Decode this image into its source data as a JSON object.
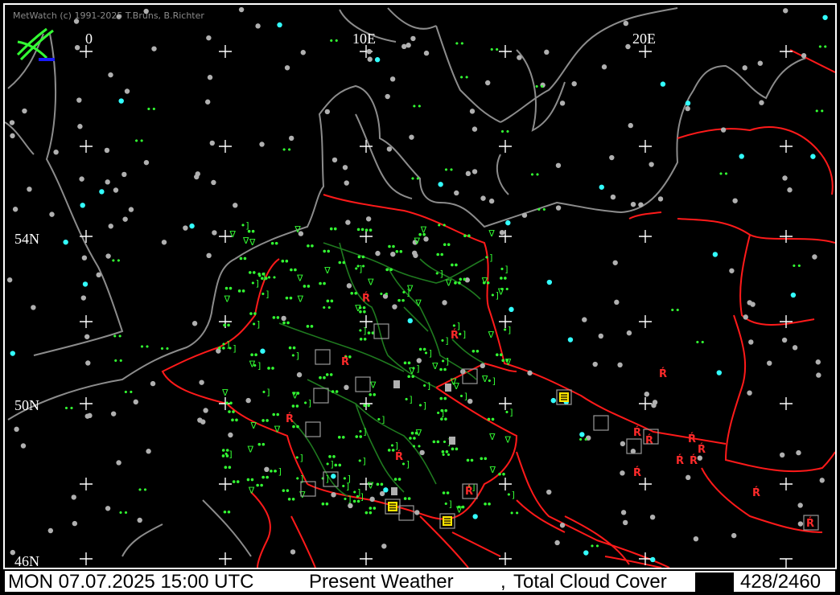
{
  "credit": "MetWatch  (c) 1991-2025 T.Bruns, B.Richter",
  "grid_labels": {
    "lon_0": "0",
    "lon_10": "10E",
    "lon_20": "20E",
    "lat_54": "54N",
    "lat_50": "50N",
    "lat_46": "46N"
  },
  "status": {
    "datetime": "MON 07.07.2025 15:00 UTC",
    "product": "Present Weather",
    "separator": ",",
    "secondary": "Total Cloud Cover",
    "count": "428/2460"
  },
  "colors": {
    "coastline": "#8c8c8c",
    "borders": "#ff1a1a",
    "german_states": "#1f7a1f",
    "weather_symbols": "#33ff33",
    "thunder_symbols": "#ff2a2a",
    "cloud_cover_dots": "#b0b0b0",
    "clear_dots": "#33ffff",
    "grid_crosses": "#ffffff"
  },
  "legend_icons": [
    "metwatch-logo-icon",
    "drizzle-icon",
    "rain-icon",
    "shower-icon",
    "thunderstorm-icon",
    "fog-icon",
    "cloud-cover-dot-icon"
  ]
}
